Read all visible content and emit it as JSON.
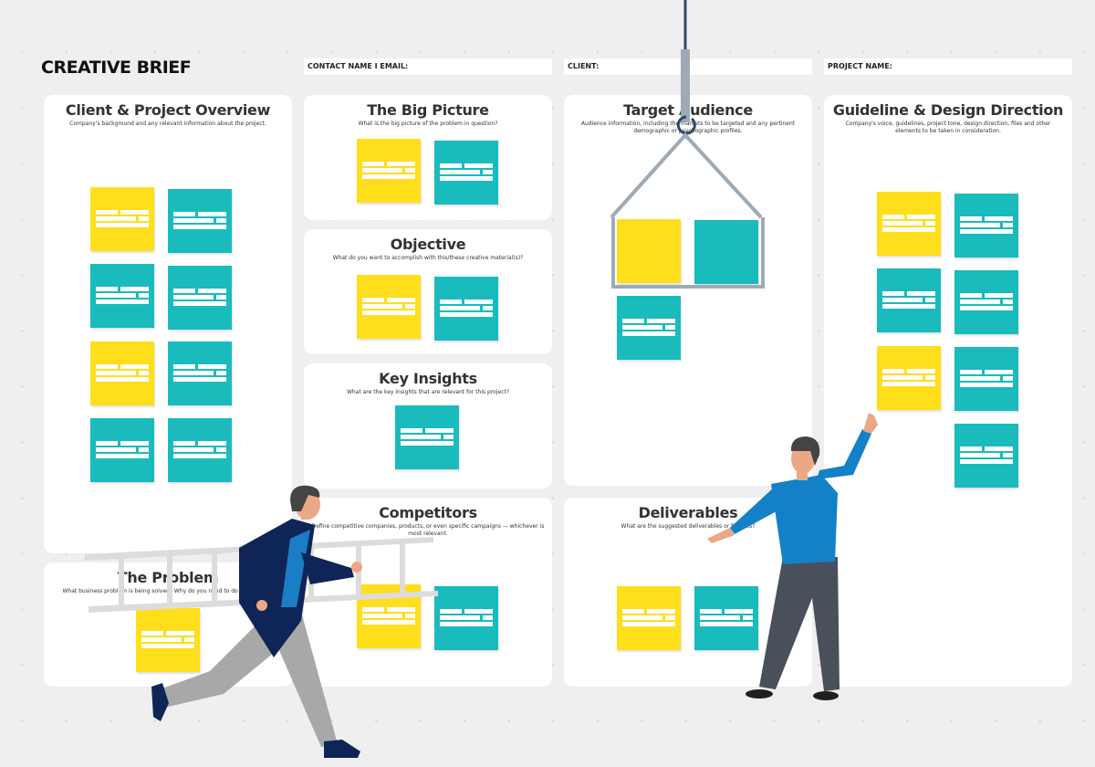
{
  "board": {
    "title": "CREATIVE BRIEF",
    "fields": [
      {
        "label": "CONTACT NAME I EMAIL:"
      },
      {
        "label": "CLIENT:"
      },
      {
        "label": "PROJECT NAME:"
      }
    ]
  },
  "colors": {
    "background": "#efefef",
    "card": "#ffffff",
    "sticky_yellow": "#ffde1b",
    "sticky_teal": "#19bbbd",
    "crane": "#9eabb6",
    "crane_cable": "#2e4a6b"
  },
  "sections": {
    "client_overview": {
      "title": "Client & Project Overview",
      "description": "Company's background and any relevant information about the project.",
      "stickies": [
        "yellow",
        "teal",
        "teal",
        "teal",
        "yellow",
        "teal",
        "teal",
        "teal"
      ]
    },
    "problem": {
      "title": "The Problem",
      "description": "What business problem is being solved? Why do you need to do this project?",
      "stickies": [
        "yellow"
      ]
    },
    "big_picture": {
      "title": "The Big Picture",
      "description": "What is the big picture of the problem in question?",
      "stickies": [
        "yellow",
        "teal"
      ]
    },
    "objective": {
      "title": "Objective",
      "description": "What do you want to accomplish with this/these creative material(s)?",
      "stickies": [
        "yellow",
        "teal"
      ]
    },
    "key_insights": {
      "title": "Key Insights",
      "description": "What are the key insights that are relevant for this project?",
      "stickies": [
        "teal"
      ]
    },
    "competitors": {
      "title": "Competitors",
      "description": "Define competitive companies, products, or even specific campaigns — whichever is most relevant.",
      "stickies": [
        "yellow",
        "teal"
      ]
    },
    "target_audience": {
      "title": "Target Audience",
      "description": "Audience information, including the markets to be targeted and any pertinent demographic or psychographic profiles.",
      "stickies": [
        "yellow",
        "teal",
        "teal"
      ]
    },
    "deliverables": {
      "title": "Deliverables",
      "description": "What are the suggested deliverables or formats?",
      "stickies": [
        "yellow",
        "teal"
      ]
    },
    "guideline": {
      "title": "Guideline & Design Direction",
      "description": "Company's voice, guidelines, project tone, design direction, files and other elements to be taken in consideration.",
      "stickies": [
        "yellow",
        "teal",
        "teal",
        "teal",
        "yellow",
        "teal",
        "teal"
      ]
    }
  },
  "illustrations": [
    {
      "name": "man-carrying-ladder"
    },
    {
      "name": "man-reaching-up"
    },
    {
      "name": "crane-hook-lifting-stickies"
    }
  ]
}
